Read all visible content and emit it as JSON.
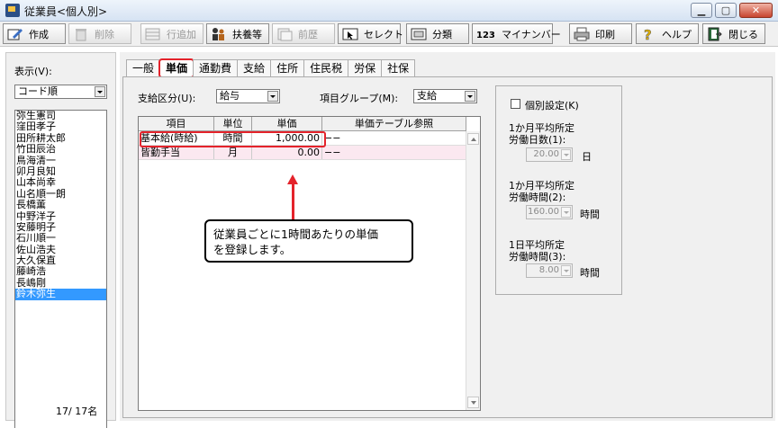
{
  "window": {
    "title": "従業員<個人別>",
    "minimize": "▁",
    "maximize": "▢",
    "close": "✕"
  },
  "toolbar": {
    "create": "作成",
    "delete": "削除",
    "add_row": "行追加",
    "dependents": "扶養等",
    "previous": "前歴",
    "select": "セレクト",
    "classify": "分類",
    "my_number": "マイナンバー",
    "print": "印刷",
    "help": "ヘルプ",
    "close": "閉じる"
  },
  "sidebar": {
    "display_label": "表示(V):",
    "sort_value": "コード順",
    "employees": [
      "弥生憲司",
      "窪田孝子",
      "田所耕太郎",
      "竹田辰治",
      "鳥海清一",
      "卯月良知",
      "山本尚幸",
      "山名順一朗",
      "長橋薫",
      "中野洋子",
      "安藤明子",
      "石川順一",
      "佐山浩夫",
      "大久保直",
      "藤崎浩",
      "長嶋剛",
      "鈴木弥生"
    ],
    "selected_index": 16,
    "count": "17/ 17名"
  },
  "tabs": [
    "一般",
    "単価",
    "通勤費",
    "支給",
    "住所",
    "住民税",
    "労保",
    "社保"
  ],
  "active_tab": 1,
  "form": {
    "pay_type_label": "支給区分(U):",
    "pay_type_value": "給与",
    "item_group_label": "項目グループ(M):",
    "item_group_value": "支給"
  },
  "table": {
    "headers": [
      "項目",
      "単位",
      "単価",
      "単価テーブル参照"
    ],
    "rows": [
      [
        "基本給(時給)",
        "時間",
        "1,000.00",
        "−−"
      ],
      [
        "皆勤手当",
        "月",
        "0.00",
        "−−"
      ]
    ]
  },
  "callout": {
    "line1": "従業員ごとに1時間あたりの単価",
    "line2": "を登録します。"
  },
  "individual": {
    "checkbox_label": "個別設定(K)",
    "avg_days_label_1": "1か月平均所定",
    "avg_days_label_2": "労働日数(1):",
    "avg_days_value": "20.00",
    "avg_days_unit": "日",
    "avg_hours_label_1": "1か月平均所定",
    "avg_hours_label_2": "労働時間(2):",
    "avg_hours_value": "160.00",
    "avg_hours_unit": "時間",
    "day_hours_label_1": "1日平均所定",
    "day_hours_label_2": "労働時間(3):",
    "day_hours_value": "8.00",
    "day_hours_unit": "時間"
  },
  "colors": {
    "highlight": "#e4232b",
    "selection": "#3399ff",
    "row_tint": "#fbe8f0"
  }
}
